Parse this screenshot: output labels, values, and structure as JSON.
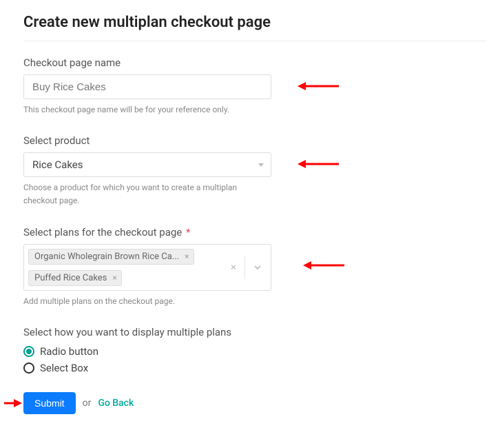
{
  "page_title": "Create new multiplan checkout page",
  "checkout_name": {
    "label": "Checkout page name",
    "value": "Buy Rice Cakes",
    "help": "This checkout page name will be for your reference only."
  },
  "select_product": {
    "label": "Select product",
    "value": "Rice Cakes",
    "help": "Choose a product for which you want to create a multiplan checkout page."
  },
  "select_plans": {
    "label": "Select plans for the checkout page",
    "required_marker": "*",
    "tags": [
      "Organic Wholegrain Brown Rice Ca...",
      "Puffed Rice Cakes"
    ],
    "help": "Add multiple plans on the checkout page."
  },
  "display_mode": {
    "label": "Select how you want to display multiple plans",
    "options": [
      "Radio button",
      "Select Box"
    ],
    "selected_index": 0
  },
  "actions": {
    "submit": "Submit",
    "or": "or",
    "go_back": "Go Back"
  }
}
